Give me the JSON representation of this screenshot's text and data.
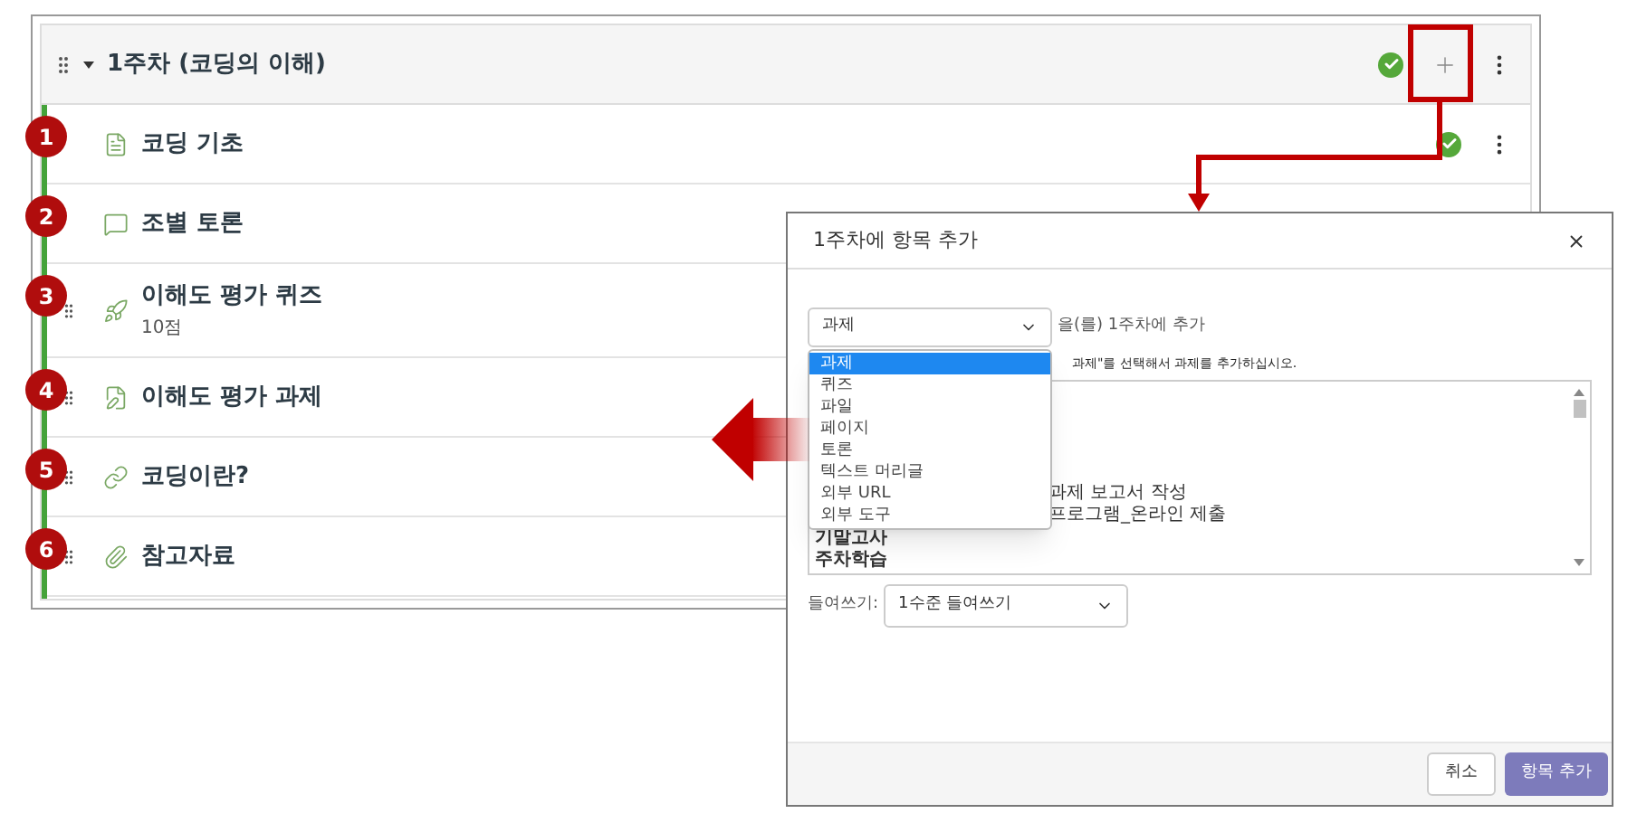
{
  "module": {
    "title": "1주차 (코딩의 이해)",
    "expanded": true,
    "published": true,
    "items": [
      {
        "step": "1",
        "kind": "page",
        "title": "코딩 기초",
        "published": true,
        "handle": false,
        "menu": true
      },
      {
        "step": "2",
        "kind": "discussion",
        "title": "조별 토론",
        "handle": false
      },
      {
        "step": "3",
        "kind": "quiz",
        "title": "이해도 평가 퀴즈",
        "subtitle": "10점",
        "handle": true
      },
      {
        "step": "4",
        "kind": "assignment",
        "title": "이해도 평가 과제",
        "handle": true
      },
      {
        "step": "5",
        "kind": "link",
        "title": "코딩이란?",
        "handle": true
      },
      {
        "step": "6",
        "kind": "file",
        "title": "참고자료",
        "handle": true
      }
    ]
  },
  "dialog": {
    "title": "1주차에 항목 추가",
    "type_select": {
      "value": "과제",
      "open": true,
      "options": [
        {
          "label": "과제",
          "selected": true
        },
        {
          "label": "퀴즈",
          "selected": false
        },
        {
          "label": "파일",
          "selected": false
        },
        {
          "label": "페이지",
          "selected": false
        },
        {
          "label": "토론",
          "selected": false
        },
        {
          "label": "텍스트 머리글",
          "selected": false
        },
        {
          "label": "외부 URL",
          "selected": false
        },
        {
          "label": "외부 도구",
          "selected": false
        }
      ]
    },
    "suffix": "을(를) 1주차에 추가",
    "hint": "과제\"를 선택해서 과제를 추가하십시오.",
    "list_items": [
      {
        "kind": "cut",
        "text": "과제 보고서 작성"
      },
      {
        "kind": "cut",
        "text": "프로그램_온라인 제출"
      },
      {
        "kind": "group",
        "text": "기말고사"
      },
      {
        "kind": "group",
        "text": "주차학습"
      }
    ],
    "indent_label": "들여쓰기:",
    "indent_value": "1수준 들여쓰기",
    "buttons": [
      {
        "kind": "cancel",
        "label": "취소"
      },
      {
        "kind": "submit",
        "label": "항목 추가"
      }
    ]
  }
}
